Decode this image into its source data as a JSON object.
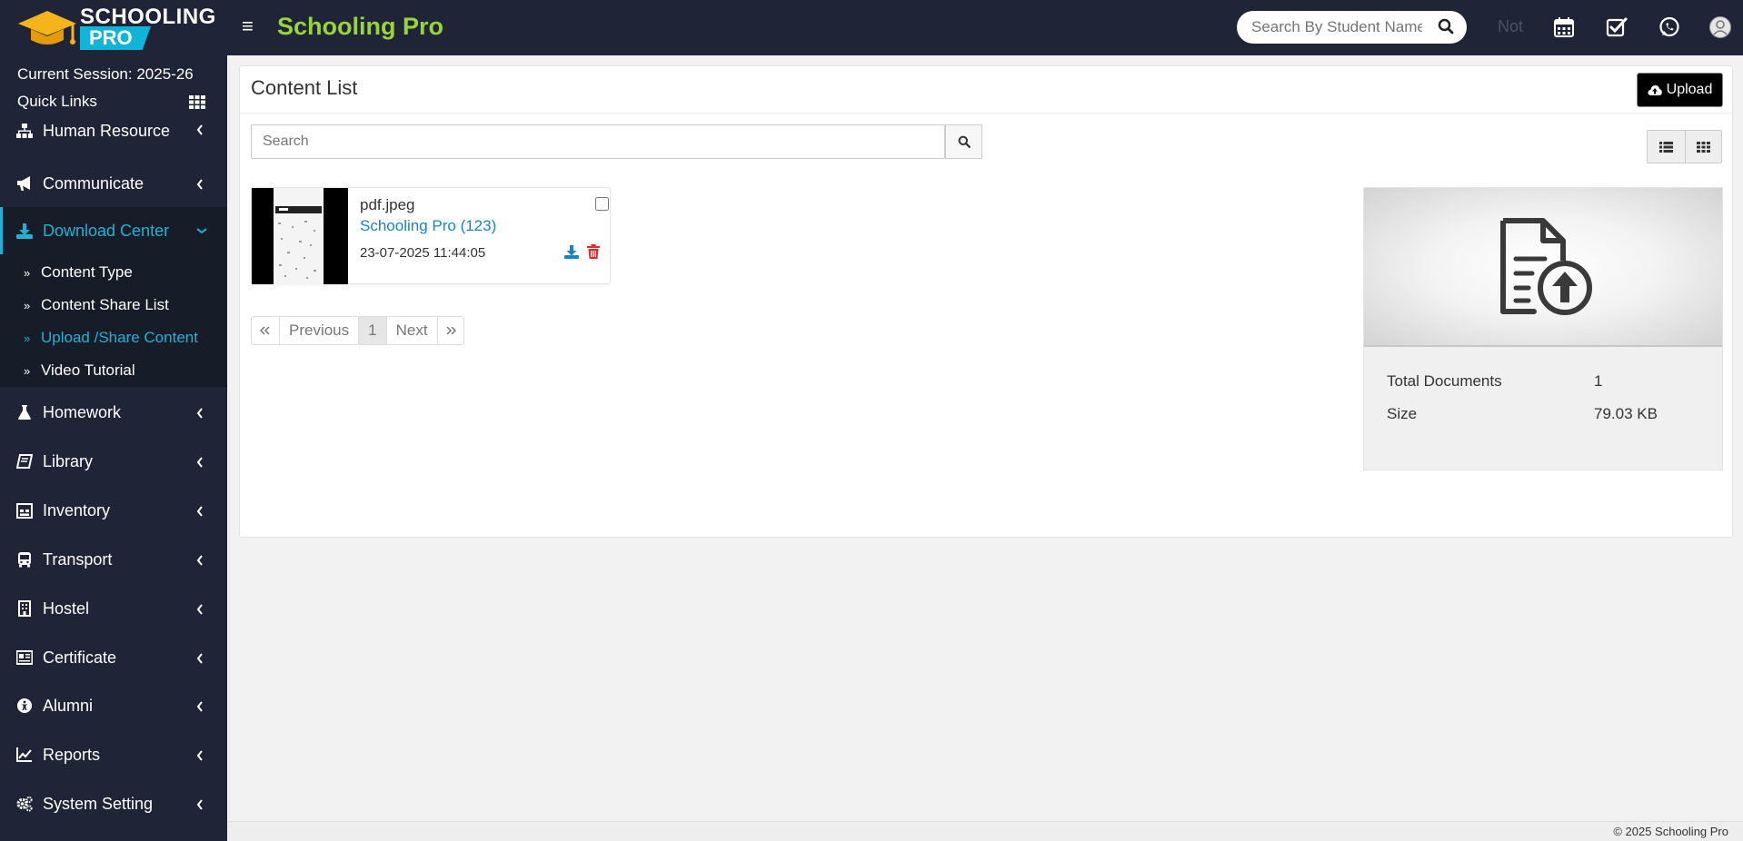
{
  "logo": {
    "line1": "SCHOOLING",
    "line2": "PRO"
  },
  "header": {
    "brand": "Schooling Pro",
    "search_placeholder": "Search By Student Name",
    "notification_text": "Not"
  },
  "sidebar": {
    "session": "Current Session: 2025-26",
    "quick_links": "Quick Links",
    "items": [
      {
        "label": "Human Resource"
      },
      {
        "label": "Communicate"
      },
      {
        "label": "Download Center"
      },
      {
        "label": "Homework"
      },
      {
        "label": "Library"
      },
      {
        "label": "Inventory"
      },
      {
        "label": "Transport"
      },
      {
        "label": "Hostel"
      },
      {
        "label": "Certificate"
      },
      {
        "label": "Alumni"
      },
      {
        "label": "Reports"
      },
      {
        "label": "System Setting"
      }
    ],
    "submenu": [
      {
        "label": "Content Type"
      },
      {
        "label": "Content Share List"
      },
      {
        "label": "Upload /Share Content"
      },
      {
        "label": "Video Tutorial"
      }
    ]
  },
  "main": {
    "title": "Content List",
    "upload_label": "Upload",
    "search_placeholder": "Search",
    "file": {
      "name": "pdf.jpeg",
      "owner": "Schooling Pro (123)",
      "date": "23-07-2025 11:44:05"
    },
    "pagination": {
      "previous": "Previous",
      "page": "1",
      "next": "Next"
    },
    "summary": {
      "total_label": "Total Documents",
      "total_value": "1",
      "size_label": "Size",
      "size_value": "79.03 KB"
    }
  },
  "footer": {
    "copyright": "© 2025 Schooling Pro"
  },
  "colors": {
    "sidebar_bg": "#1f2536",
    "accent": "#22b0d3",
    "brand_green": "#9bd43a",
    "link_blue": "#1a84c0",
    "delete_red": "#e02b2b"
  }
}
